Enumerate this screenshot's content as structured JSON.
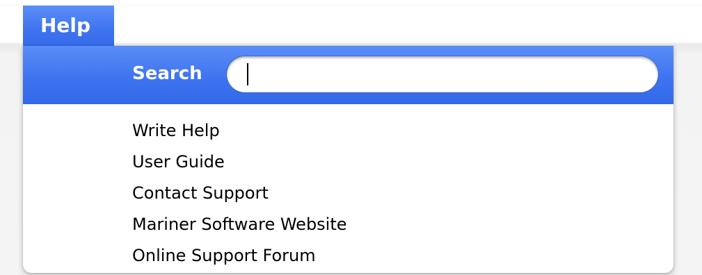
{
  "menu": {
    "title": "Help",
    "search": {
      "label": "Search",
      "value": "",
      "placeholder": ""
    },
    "items": [
      {
        "label": "Write Help"
      },
      {
        "label": "User Guide"
      },
      {
        "label": "Contact Support"
      },
      {
        "label": "Mariner Software Website"
      },
      {
        "label": "Online Support Forum"
      }
    ]
  },
  "colors": {
    "highlight": "#3f74f0",
    "menu_text": "#000000",
    "highlight_text": "#ffffff"
  }
}
